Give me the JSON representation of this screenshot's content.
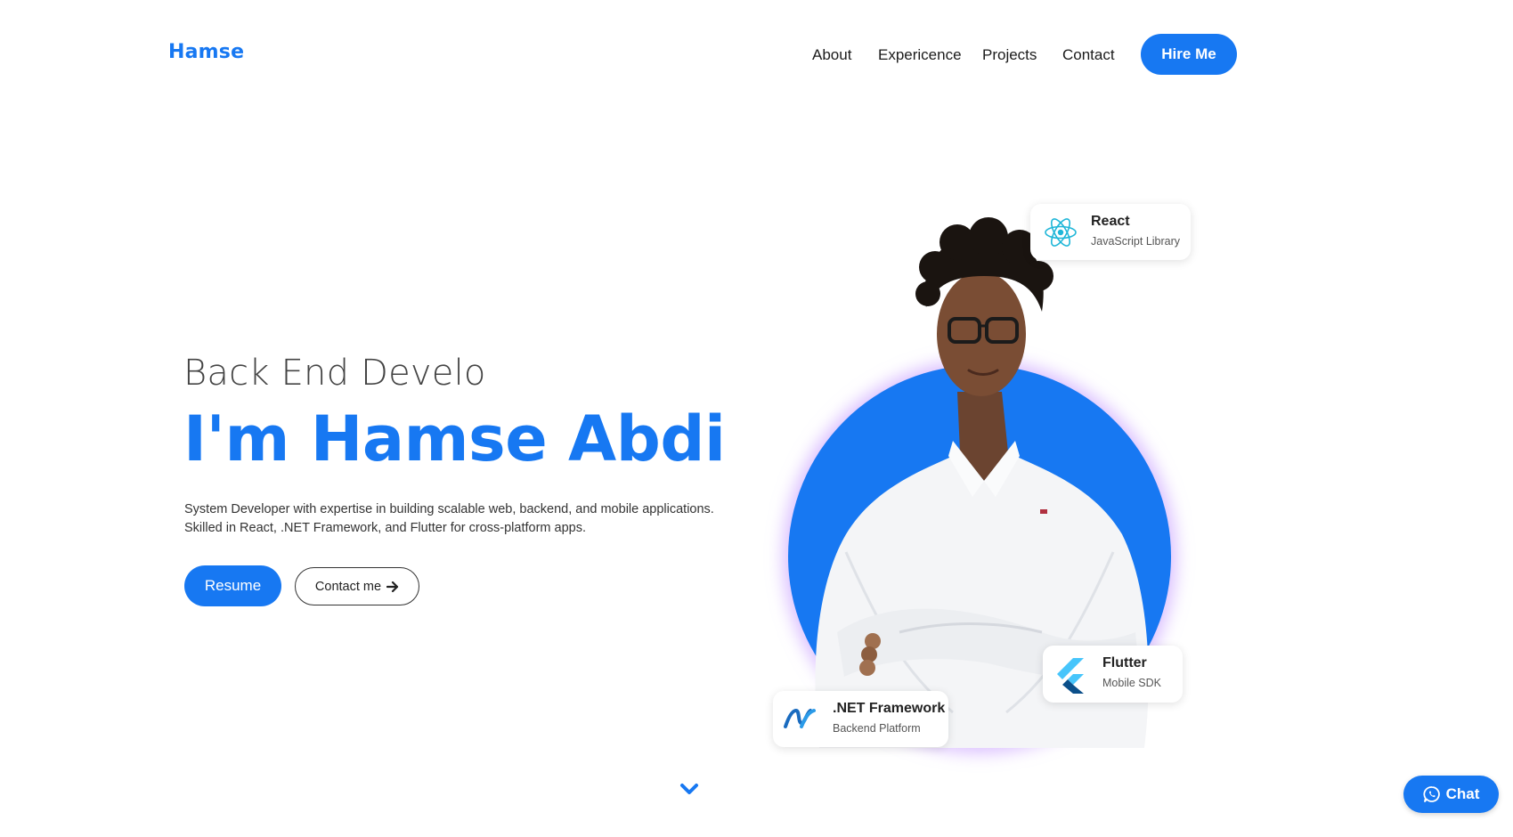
{
  "brand": {
    "logo": "Hamse",
    "accent": "#1778f2"
  },
  "nav": {
    "links": [
      "About",
      "Expericence",
      "Projects",
      "Contact"
    ],
    "cta": "Hire Me"
  },
  "hero": {
    "typed_subtitle": "Back End Develo",
    "headline": "I'm Hamse Abdi",
    "description": [
      "System Developer with expertise in building scalable web, backend, and mobile applications.",
      "Skilled in React, .NET Framework, and Flutter for cross-platform apps."
    ],
    "resume_label": "Resume",
    "contact_label": "Contact me"
  },
  "tech_cards": {
    "react": {
      "title": "React",
      "subtitle": "JavaScript Library",
      "icon": "react-icon"
    },
    "flutter": {
      "title": "Flutter",
      "subtitle": "Mobile SDK",
      "icon": "flutter-icon"
    },
    "dotnet": {
      "title": ".NET Framework",
      "subtitle": "Backend Platform",
      "icon": "dotnet-icon"
    }
  },
  "chat": {
    "label": "Chat",
    "icon": "whatsapp-icon"
  },
  "scroll_icon": "chevron-down-icon"
}
